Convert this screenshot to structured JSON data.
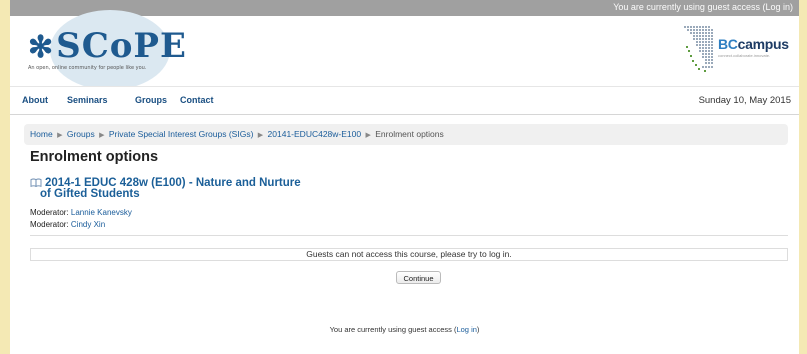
{
  "topbar": {
    "guest_text": "You are currently using guest access (",
    "login_label": "Log in",
    "close_paren": ")"
  },
  "header": {
    "logo_text": "SCoPE",
    "logo_tagline": "An open, online community for people like you.",
    "partner_logo_prefix": "BC",
    "partner_logo_suffix": "campus",
    "partner_tagline": "connect.collaborate.innovate."
  },
  "nav": {
    "items": [
      "About",
      "Seminars",
      "Groups",
      "Contact"
    ],
    "date": "Sunday 10, May 2015"
  },
  "breadcrumb": {
    "items": [
      "Home",
      "Groups",
      "Private Special Interest Groups (SIGs)",
      "20141-EDUC428w-E100"
    ],
    "current": "Enrolment options",
    "separator": "▶"
  },
  "main": {
    "heading": "Enrolment options",
    "course_title_line1": "2014-1 EDUC 428w (E100) - Nature and Nurture",
    "course_title_line2": "of Gifted Students",
    "moderators": [
      {
        "label": "Moderator: ",
        "name": "Lannie Kanevsky"
      },
      {
        "label": "Moderator: ",
        "name": "Cindy Xin"
      }
    ],
    "notice": "Guests can not access this course, please try to log in.",
    "continue_label": "Continue"
  },
  "footer": {
    "guest_text": "You are currently using guest access (",
    "login_label": "Log in",
    "close_paren": ")"
  },
  "colors": {
    "brand_blue": "#1f5a8f",
    "link_blue": "#1a5c9a",
    "topbar_gray": "#a0a0a0",
    "page_border": "#f4e9b4"
  }
}
